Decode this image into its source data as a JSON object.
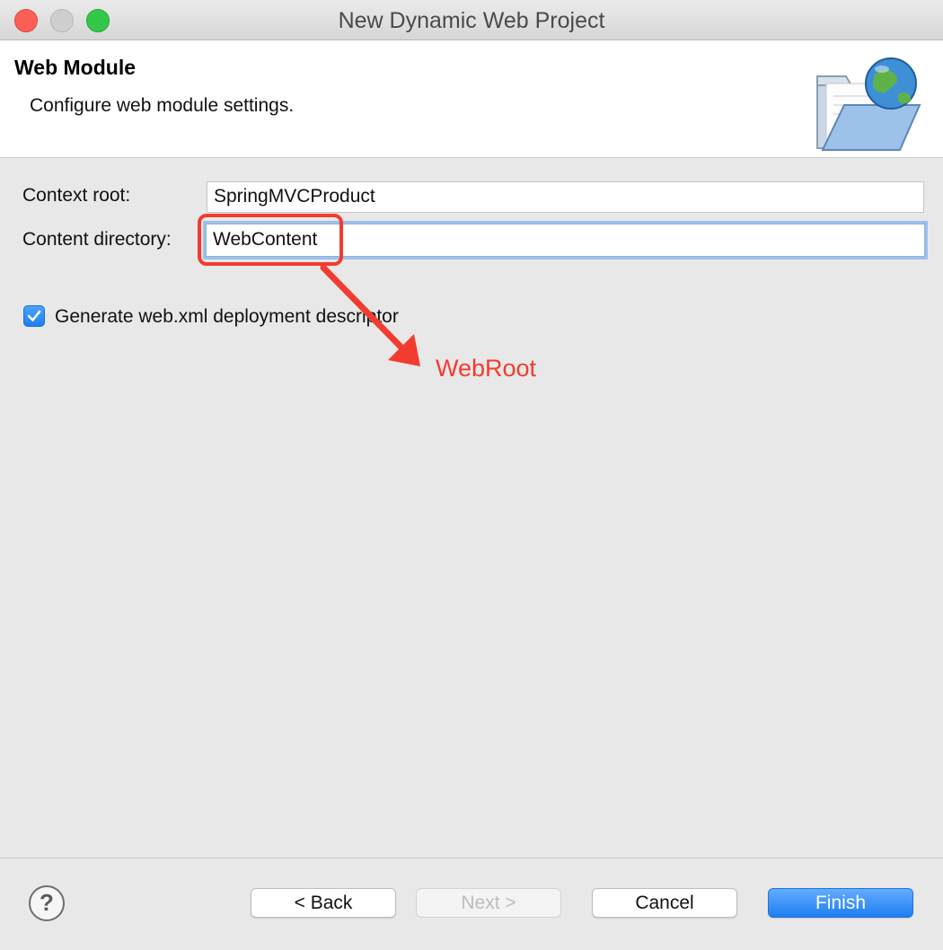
{
  "window": {
    "title": "New Dynamic Web Project",
    "controls": [
      "close-button",
      "minimize-button",
      "zoom-button"
    ]
  },
  "header": {
    "title": "Web Module",
    "description": "Configure web module settings.",
    "icon": "web-folder-globe-icon"
  },
  "form": {
    "context_root": {
      "label": "Context root:",
      "value": "SpringMVCProduct"
    },
    "content_directory": {
      "label": "Content directory:",
      "value": "WebContent"
    },
    "generate_web_xml": {
      "label": "Generate web.xml deployment descriptor",
      "checked": true
    }
  },
  "annotation": {
    "text": "WebRoot",
    "color": "#f23c2f"
  },
  "footer": {
    "help_icon": "question-mark-icon",
    "help_glyph": "?",
    "back_label": "< Back",
    "next_label": "Next >",
    "next_enabled": false,
    "cancel_label": "Cancel",
    "finish_label": "Finish"
  },
  "colors": {
    "accent": "#1e7ff3",
    "focus_ring": "#9cc0ea",
    "annotation": "#f23c2f"
  }
}
